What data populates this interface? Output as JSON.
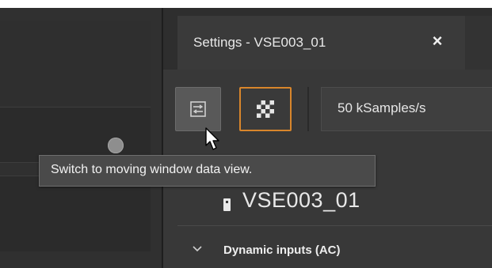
{
  "settings_panel": {
    "tab_title": "Settings - VSE003_01",
    "close_label": "×",
    "toolbar": {
      "moving_window_button": {
        "icon": "moving-window-view-icon",
        "state": "hovered"
      },
      "static_button": {
        "icon": "checkered-view-icon",
        "state": "selected",
        "accent_color": "#d9862b"
      },
      "sample_rate": "50 kSamples/s"
    },
    "device": {
      "icon": "device-icon",
      "name": "VSE003_01"
    },
    "section": {
      "icon": "chevron-down-icon",
      "title": "Dynamic inputs (AC)"
    }
  },
  "tooltip": {
    "text": "Switch to moving window data view."
  },
  "colors": {
    "panel_bg": "#383838",
    "workspace_bg": "#303030",
    "accent": "#d9862b"
  }
}
